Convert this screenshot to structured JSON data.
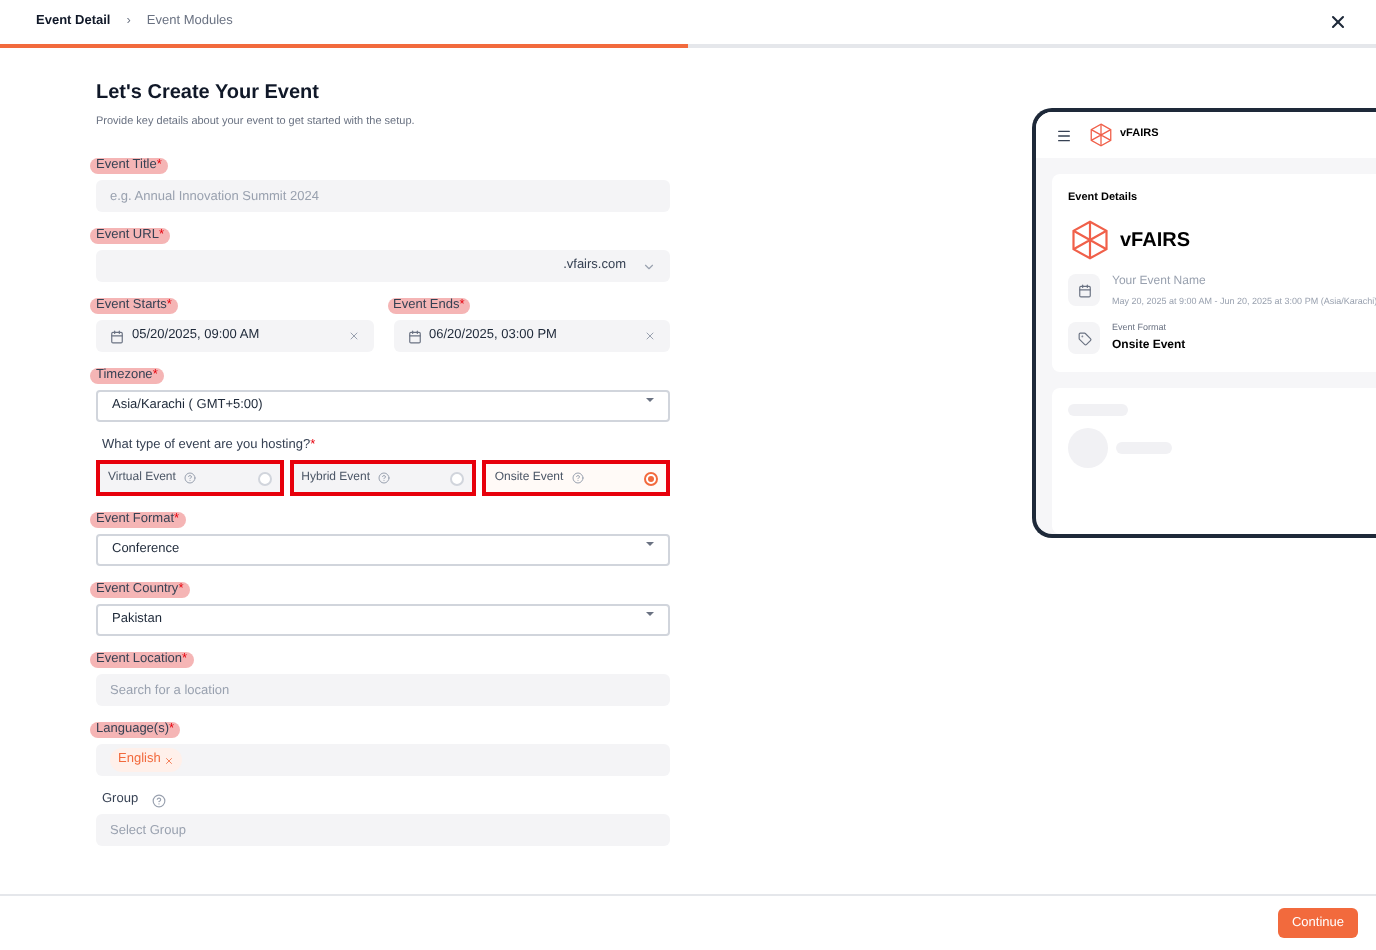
{
  "steps": [
    {
      "label": "Event Detail",
      "selected": true
    },
    {
      "label": "Event Modules",
      "selected": false
    }
  ],
  "breadcrumb_separator": "›",
  "progress": {
    "level": 0.5
  },
  "heading": "Let's Create Your Event",
  "subheading": "Provide key details about your event to get started with the setup.",
  "fields": [
    {
      "kind": "input",
      "label": "Event Title",
      "required_mark": "*",
      "highlighted": true,
      "placeholder": "e.g. Annual Innovation Summit 2024"
    },
    {
      "kind": "url",
      "label": "Event URL",
      "required_mark": "*",
      "highlighted": true,
      "suffix": ".vfairs.com"
    },
    {
      "kind": "dates",
      "items": [
        {
          "label": "Event Starts",
          "required_mark": "*",
          "highlighted": true,
          "value": "05/20/2025, 09:00 AM"
        },
        {
          "label": "Event Ends",
          "required_mark": "*",
          "highlighted": true,
          "value": "06/20/2025, 03:00 PM"
        }
      ]
    },
    {
      "kind": "select",
      "label": "Timezone",
      "required_mark": "*",
      "highlighted": true,
      "value": "Asia/Karachi ( GMT+5:00)"
    },
    {
      "kind": "radio",
      "label": "What type of event are you hosting?",
      "required_mark": "*",
      "highlighted": false,
      "options": [
        {
          "label": "Virtual Event",
          "selected": false,
          "flagged": true
        },
        {
          "label": "Hybrid Event",
          "selected": false,
          "flagged": true
        },
        {
          "label": "Onsite Event",
          "selected": true,
          "flagged": true
        }
      ]
    },
    {
      "kind": "select",
      "label": "Event Format",
      "required_mark": "*",
      "highlighted": true,
      "value": "Conference"
    },
    {
      "kind": "select",
      "label": "Event Country",
      "required_mark": "*",
      "highlighted": true,
      "value": "Pakistan"
    },
    {
      "kind": "input",
      "label": "Event Location",
      "required_mark": "*",
      "highlighted": true,
      "placeholder": "Search for a location"
    },
    {
      "kind": "tags",
      "label": "Language(s)",
      "required_mark": "*",
      "highlighted": true,
      "tags": [
        "English"
      ]
    },
    {
      "kind": "input",
      "label": "Group",
      "highlighted": false,
      "help": true,
      "placeholder": "Select Group"
    }
  ],
  "preview": {
    "header_brand": "vFAIRS",
    "brand": "vFAIRS",
    "card_title": "Event Details",
    "event_name": "Your Event Name",
    "event_dates": "May 20, 2025 at 9:00 AM - Jun 20, 2025 at 3:00 PM (Asia/Karachi)",
    "format_label": "Event Format",
    "format_value": "Onsite Event"
  },
  "footer": {
    "button": "Continue"
  }
}
